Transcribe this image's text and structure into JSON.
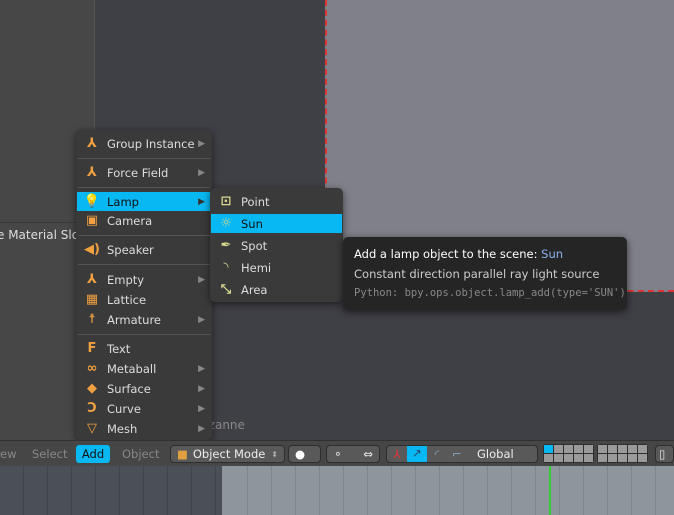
{
  "viewport": {
    "left_panel_text": "e Material Slo…",
    "object_label": "(68) Suzanne"
  },
  "add_menu": {
    "items": [
      {
        "label": "Group Instance",
        "icon": "empty-axes-icon",
        "submenu": true
      },
      {
        "label": "Force Field",
        "icon": "empty-axes-icon",
        "submenu": true
      },
      {
        "label": "Lamp",
        "icon": "lamp-bulb-icon",
        "submenu": true,
        "highlighted": true
      },
      {
        "label": "Camera",
        "icon": "camera-icon",
        "submenu": false
      },
      {
        "label": "Speaker",
        "icon": "speaker-icon",
        "submenu": false
      },
      {
        "label": "Empty",
        "icon": "empty-axes-icon",
        "submenu": true
      },
      {
        "label": "Lattice",
        "icon": "lattice-icon",
        "submenu": false
      },
      {
        "label": "Armature",
        "icon": "armature-icon",
        "submenu": true
      },
      {
        "label": "Text",
        "icon": "text-icon",
        "submenu": false
      },
      {
        "label": "Metaball",
        "icon": "metaball-icon",
        "submenu": true
      },
      {
        "label": "Surface",
        "icon": "surface-icon",
        "submenu": true
      },
      {
        "label": "Curve",
        "icon": "curve-icon",
        "submenu": true
      },
      {
        "label": "Mesh",
        "icon": "mesh-icon",
        "submenu": true
      }
    ]
  },
  "lamp_menu": {
    "items": [
      {
        "label": "Point",
        "icon": "point-lamp-icon"
      },
      {
        "label": "Sun",
        "icon": "sun-lamp-icon",
        "highlighted": true
      },
      {
        "label": "Spot",
        "icon": "spot-lamp-icon"
      },
      {
        "label": "Hemi",
        "icon": "hemi-lamp-icon"
      },
      {
        "label": "Area",
        "icon": "area-lamp-icon"
      }
    ]
  },
  "tooltip": {
    "title": "Add a lamp object to the scene:",
    "value": "Sun",
    "description": "Constant direction parallel ray light source",
    "python": "Python: bpy.ops.object.lamp_add(type='SUN')"
  },
  "header": {
    "view": "ew",
    "select": "Select",
    "add": "Add",
    "object": "Object",
    "mode": "Object Mode",
    "orientation": "Global"
  },
  "colors": {
    "highlight": "#08b8f3",
    "menu_bg": "#3a3a3a",
    "icon_orange": "#f0a040",
    "frame_marker": "#33cc33"
  }
}
